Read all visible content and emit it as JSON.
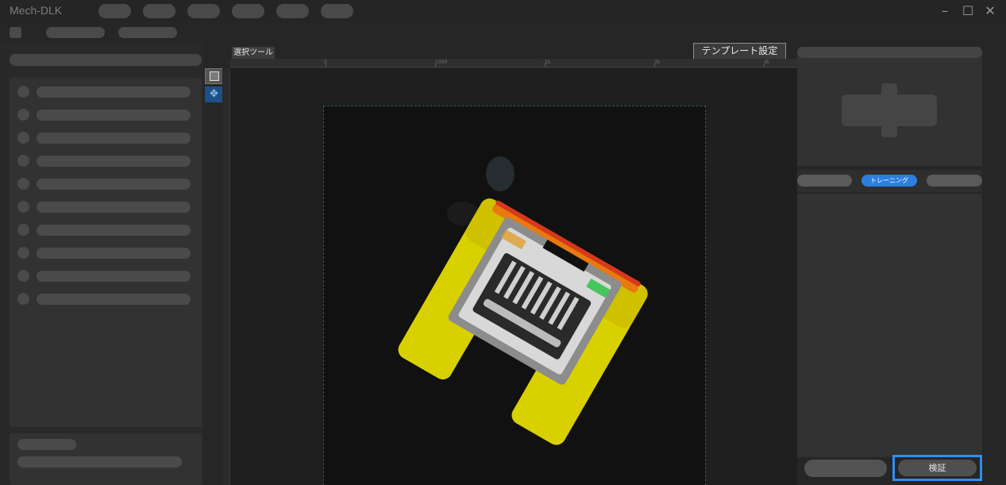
{
  "window": {
    "title": "Mech-DLK",
    "controls": [
      "minimize-icon",
      "maximize-icon",
      "close-icon"
    ]
  },
  "canvas": {
    "selection_tool_label": "選択ツール",
    "template_button_label": "テンプレート設定",
    "hruler_ticks": [
      "0",
      "1000",
      "2k",
      "3k",
      "4k"
    ]
  },
  "right_panel": {
    "active_tab_label": "トレーニング",
    "verify_button_label": "検証"
  }
}
